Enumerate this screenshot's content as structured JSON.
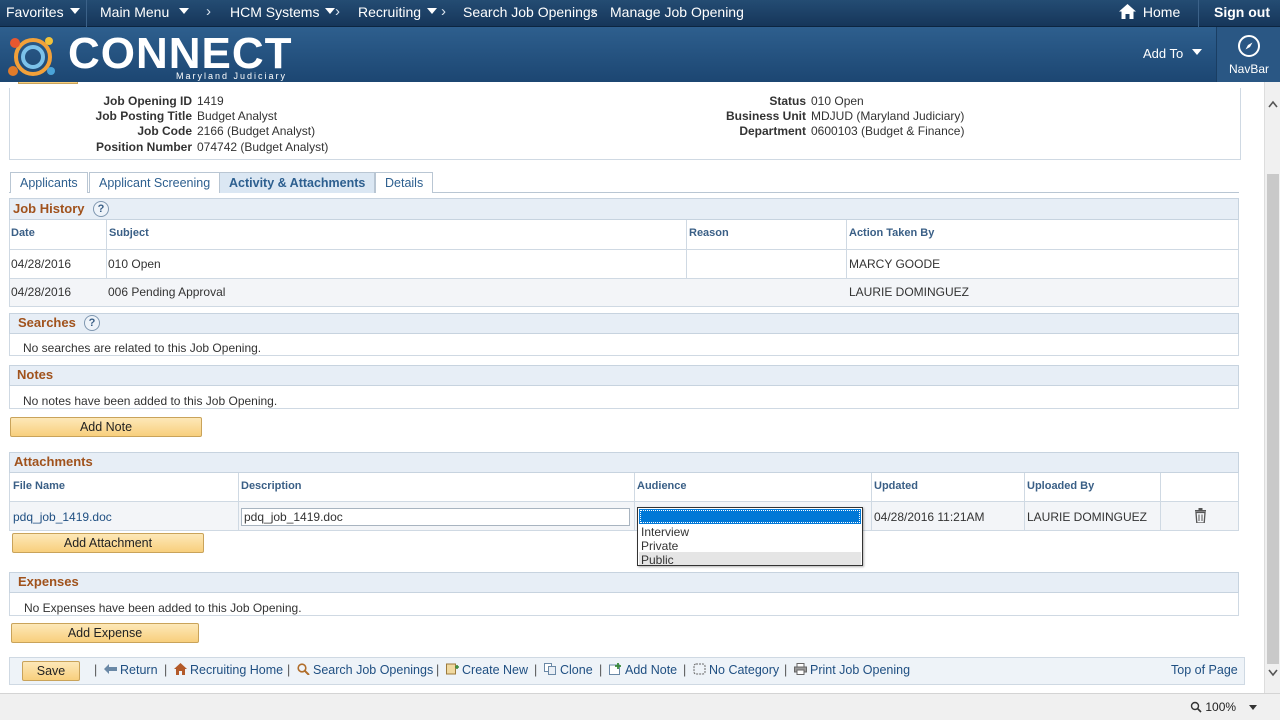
{
  "topnav": {
    "favorites": "Favorites",
    "main_menu": "Main Menu",
    "breadcrumbs": [
      "HCM Systems",
      "Recruiting",
      "Search Job Openings",
      "Manage Job Opening"
    ],
    "home": "Home",
    "sign_out": "Sign out"
  },
  "banner": {
    "brand": "CONNECT",
    "brand_sub": "Maryland Judiciary",
    "add_to": "Add To",
    "navbar": "NavBar"
  },
  "header_fields": {
    "job_opening_id_label": "Job Opening ID",
    "job_opening_id": "1419",
    "job_posting_title_label": "Job Posting Title",
    "job_posting_title": "Budget Analyst",
    "job_code_label": "Job Code",
    "job_code": "2166 (Budget Analyst)",
    "position_number_label": "Position Number",
    "position_number": "074742 (Budget Analyst)",
    "status_label": "Status",
    "status": "010 Open",
    "business_unit_label": "Business Unit",
    "business_unit": "MDJUD (Maryland Judiciary)",
    "department_label": "Department",
    "department": "0600103 (Budget & Finance)"
  },
  "tabs": [
    "Applicants",
    "Applicant Screening",
    "Activity & Attachments",
    "Details"
  ],
  "job_history": {
    "title": "Job History",
    "columns": [
      "Date",
      "Subject",
      "Reason",
      "Action Taken By"
    ],
    "rows": [
      {
        "date": "04/28/2016",
        "subject": "010 Open",
        "reason": "",
        "action_by": "MARCY GOODE"
      },
      {
        "date": "04/28/2016",
        "subject": "006 Pending Approval",
        "reason": "",
        "action_by": "LAURIE DOMINGUEZ"
      }
    ]
  },
  "searches": {
    "title": "Searches",
    "empty": "No searches are related to this Job Opening."
  },
  "notes": {
    "title": "Notes",
    "empty": "No notes have been added to this Job Opening.",
    "add_button": "Add Note"
  },
  "attachments": {
    "title": "Attachments",
    "columns": [
      "File Name",
      "Description",
      "Audience",
      "Updated",
      "Uploaded By"
    ],
    "row": {
      "file_name": "pdq_job_1419.doc",
      "description": "pdq_job_1419.doc",
      "audience": "",
      "updated": "04/28/2016 11:21AM",
      "uploaded_by": "LAURIE DOMINGUEZ"
    },
    "audience_options": [
      "Interview",
      "Private",
      "Public"
    ],
    "add_button": "Add Attachment"
  },
  "expenses": {
    "title": "Expenses",
    "empty": "No Expenses have been added to this Job Opening.",
    "add_button": "Add Expense"
  },
  "bottom_bar": {
    "save": "Save",
    "links": [
      "Return",
      "Recruiting Home",
      "Search Job Openings",
      "Create New",
      "Clone",
      "Add Note",
      "No Category",
      "Print Job Opening"
    ],
    "top_of_page": "Top of Page"
  },
  "statusbar": {
    "zoom": "100%"
  },
  "colors": {
    "nav_bg": "#16365a",
    "banner_bg": "#1c4672",
    "section_title": "#a0521c",
    "link": "#1f4f82",
    "button_yellow": "#f8cf7d"
  }
}
